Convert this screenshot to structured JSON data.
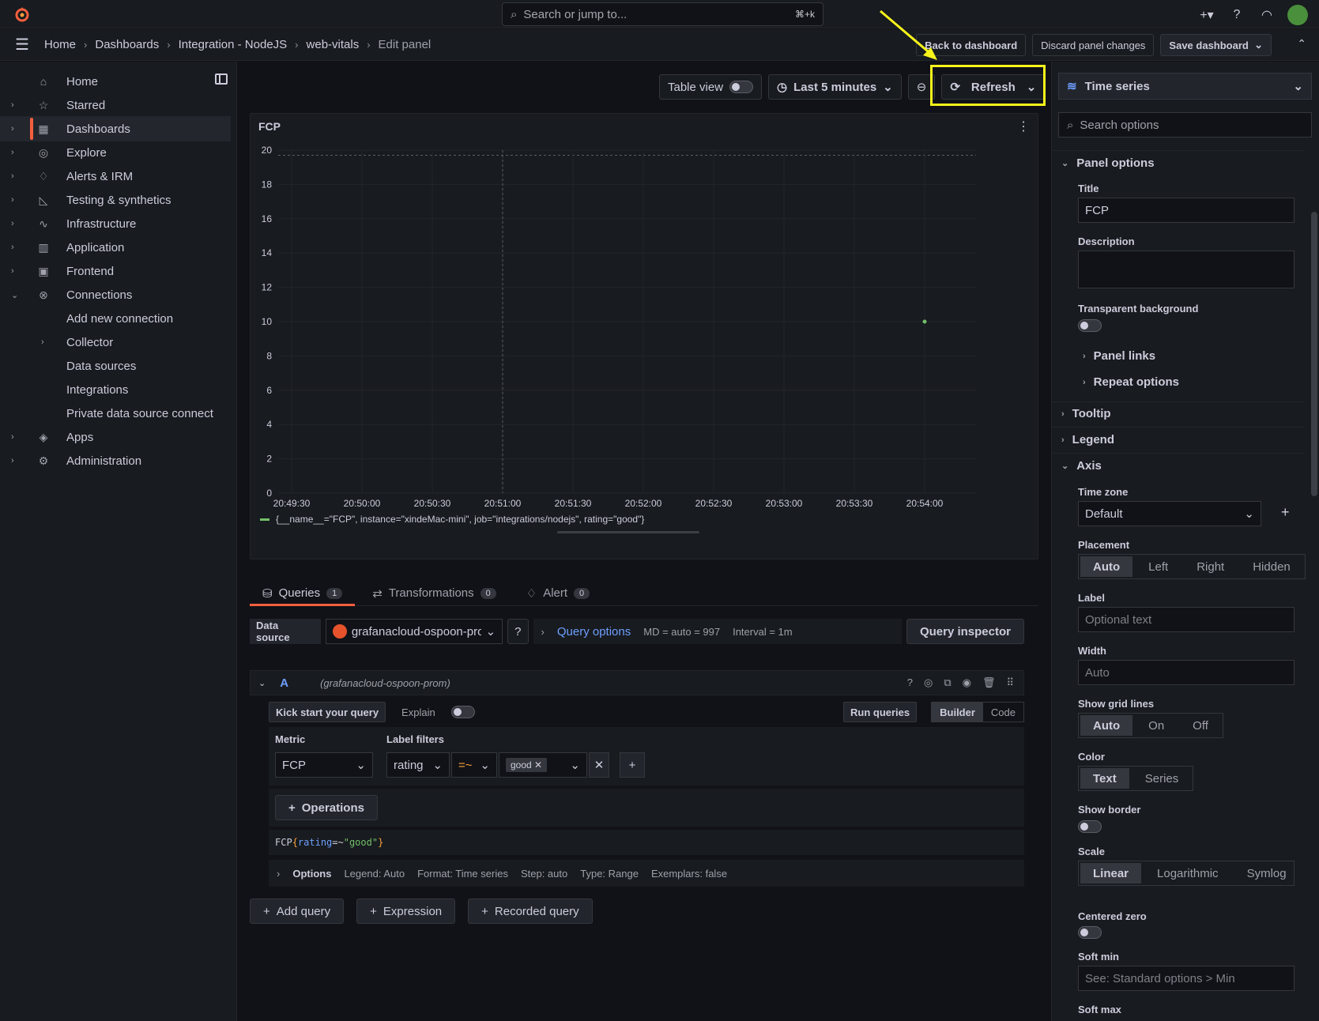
{
  "topbar": {
    "search_placeholder": "Search or jump to...",
    "search_shortcut": "⌘+k"
  },
  "breadcrumbs": [
    "Home",
    "Dashboards",
    "Integration - NodeJS",
    "web-vitals",
    "Edit panel"
  ],
  "header_actions": {
    "back": "Back to dashboard",
    "discard": "Discard panel changes",
    "save": "Save dashboard"
  },
  "sidebar": {
    "items": [
      {
        "label": "Home",
        "icon": "home-icon"
      },
      {
        "label": "Starred",
        "icon": "star-icon"
      },
      {
        "label": "Dashboards",
        "icon": "grid-icon"
      },
      {
        "label": "Explore",
        "icon": "compass-icon"
      },
      {
        "label": "Alerts & IRM",
        "icon": "bell-icon"
      },
      {
        "label": "Testing & synthetics",
        "icon": "chart-icon"
      },
      {
        "label": "Infrastructure",
        "icon": "heartbeat-icon"
      },
      {
        "label": "Application",
        "icon": "bars-icon"
      },
      {
        "label": "Frontend",
        "icon": "browser-icon"
      },
      {
        "label": "Connections",
        "icon": "link-icon"
      },
      {
        "label": "Add new connection"
      },
      {
        "label": "Collector"
      },
      {
        "label": "Data sources"
      },
      {
        "label": "Integrations"
      },
      {
        "label": "Private data source connect"
      },
      {
        "label": "Apps",
        "icon": "layers-icon"
      },
      {
        "label": "Administration",
        "icon": "gear-icon"
      }
    ]
  },
  "toolbar": {
    "table_view": "Table view",
    "time_range": "Last 5 minutes",
    "refresh": "Refresh"
  },
  "panel": {
    "title": "FCP",
    "legend": "{__name__=\"FCP\", instance=\"xindeMac-mini\", job=\"integrations/nodejs\", rating=\"good\"}"
  },
  "chart_data": {
    "type": "scatter",
    "title": "FCP",
    "x_ticks": [
      "20:49:30",
      "20:50:00",
      "20:50:30",
      "20:51:00",
      "20:51:30",
      "20:52:00",
      "20:52:30",
      "20:53:00",
      "20:53:30",
      "20:54:00"
    ],
    "y_ticks": [
      0,
      2,
      4,
      6,
      8,
      10,
      12,
      14,
      16,
      18,
      20
    ],
    "ylim": [
      0,
      20
    ],
    "grid": true,
    "legend_placement": "bottom-left",
    "series": [
      {
        "name": "{__name__=\"FCP\", instance=\"xindeMac-mini\", job=\"integrations/nodejs\", rating=\"good\"}",
        "color": "#73bf69",
        "points": [
          {
            "x": "20:54:00",
            "y": 10
          }
        ]
      }
    ]
  },
  "tabs": [
    {
      "label": "Queries",
      "count": "1"
    },
    {
      "label": "Transformations",
      "count": "0"
    },
    {
      "label": "Alert",
      "count": "0"
    }
  ],
  "datasource": {
    "label": "Data source",
    "value": "grafanacloud-ospoon-prom",
    "query_options": "Query options",
    "md": "MD = auto = 997",
    "interval": "Interval = 1m",
    "inspector": "Query inspector"
  },
  "query": {
    "ref": "A",
    "ds": "(grafanacloud-ospoon-prom)",
    "kick_start": "Kick start your query",
    "explain": "Explain",
    "run": "Run queries",
    "builder": "Builder",
    "code": "Code",
    "metric_label": "Metric",
    "metric_value": "FCP",
    "label_filters": "Label filters",
    "filter_label": "rating",
    "filter_op": "=~",
    "filter_value": "good",
    "operations": "Operations",
    "code_metric": "FCP",
    "code_brace_open": "{",
    "code_key": "rating",
    "code_op": "=~",
    "code_val": "\"good\"",
    "code_brace_close": "}",
    "options": "Options",
    "opt_legend": "Legend: Auto",
    "opt_format": "Format: Time series",
    "opt_step": "Step: auto",
    "opt_type": "Type: Range",
    "opt_exemplars": "Exemplars: false"
  },
  "add_buttons": {
    "add_query": "Add query",
    "expression": "Expression",
    "recorded": "Recorded query"
  },
  "options_pane": {
    "viz": "Time series",
    "search_placeholder": "Search options",
    "panel_options": "Panel options",
    "title_label": "Title",
    "title_value": "FCP",
    "description_label": "Description",
    "transparent_label": "Transparent background",
    "panel_links": "Panel links",
    "repeat_options": "Repeat options",
    "tooltip": "Tooltip",
    "legend": "Legend",
    "axis": "Axis",
    "timezone_label": "Time zone",
    "timezone_value": "Default",
    "placement_label": "Placement",
    "placement": [
      "Auto",
      "Left",
      "Right",
      "Hidden"
    ],
    "label_label": "Label",
    "label_placeholder": "Optional text",
    "width_label": "Width",
    "width_placeholder": "Auto",
    "grid_label": "Show grid lines",
    "grid": [
      "Auto",
      "On",
      "Off"
    ],
    "color_label": "Color",
    "color": [
      "Text",
      "Series"
    ],
    "border_label": "Show border",
    "scale_label": "Scale",
    "scale": [
      "Linear",
      "Logarithmic",
      "Symlog"
    ],
    "centered_label": "Centered zero",
    "softmin_label": "Soft min",
    "softmin_placeholder": "See: Standard options > Min",
    "softmax_label": "Soft max"
  },
  "colors": {
    "accent": "#f55f3e",
    "highlight": "#f7f31b",
    "series": "#73bf69",
    "link": "#6e9fff"
  }
}
